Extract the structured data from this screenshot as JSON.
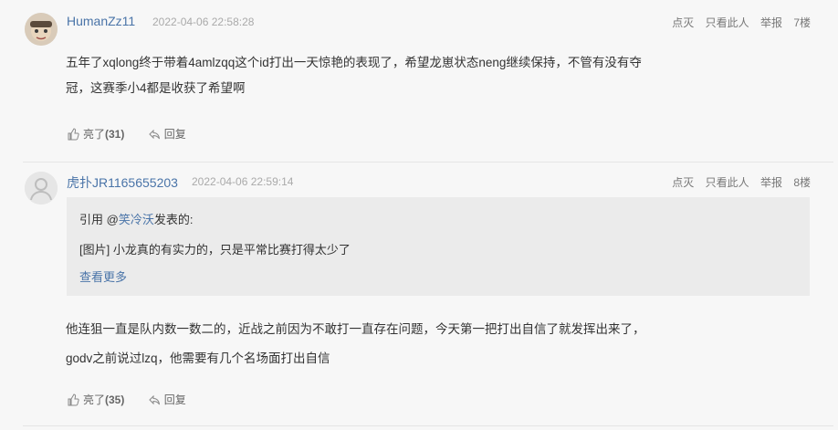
{
  "posts": [
    {
      "username": "HumanZz11",
      "time": "2022-04-06 22:58:28",
      "actions": {
        "light_off": "点灭",
        "only_this": "只看此人",
        "report": "举报",
        "floor": "7楼"
      },
      "body_lines": [
        "五年了xqlong终于带着4amlzqq这个id打出一天惊艳的表现了，希望龙崽状态neng继续保持，不管有没有夺",
        "冠，这赛季小4都是收获了希望啊"
      ],
      "like_label": "亮了",
      "like_count": "(31)",
      "reply_label": "回复",
      "avatar_icon": "user-avatar-photo-icon"
    },
    {
      "username": "虎扑JR1165655203",
      "time": "2022-04-06 22:59:14",
      "actions": {
        "light_off": "点灭",
        "only_this": "只看此人",
        "report": "举报",
        "floor": "8楼"
      },
      "quote": {
        "prefix": "引用 @",
        "quoted_user": "笑冷沃",
        "suffix": "发表的:",
        "content": "[图片] 小龙真的有实力的，只是平常比赛打得太少了",
        "more": "查看更多"
      },
      "body_lines": [
        "他连狙一直是队内数一数二的，近战之前因为不敢打一直存在问题，今天第一把打出自信了就发挥出来了，",
        "godv之前说过lzq，他需要有几个名场面打出自信"
      ],
      "like_label": "亮了",
      "like_count": "(35)",
      "reply_label": "回复",
      "avatar_icon": "default-avatar-icon"
    }
  ],
  "colors": {
    "link": "#4a74a8",
    "background": "#f7f7f7",
    "quote_bg": "#ebebeb"
  }
}
